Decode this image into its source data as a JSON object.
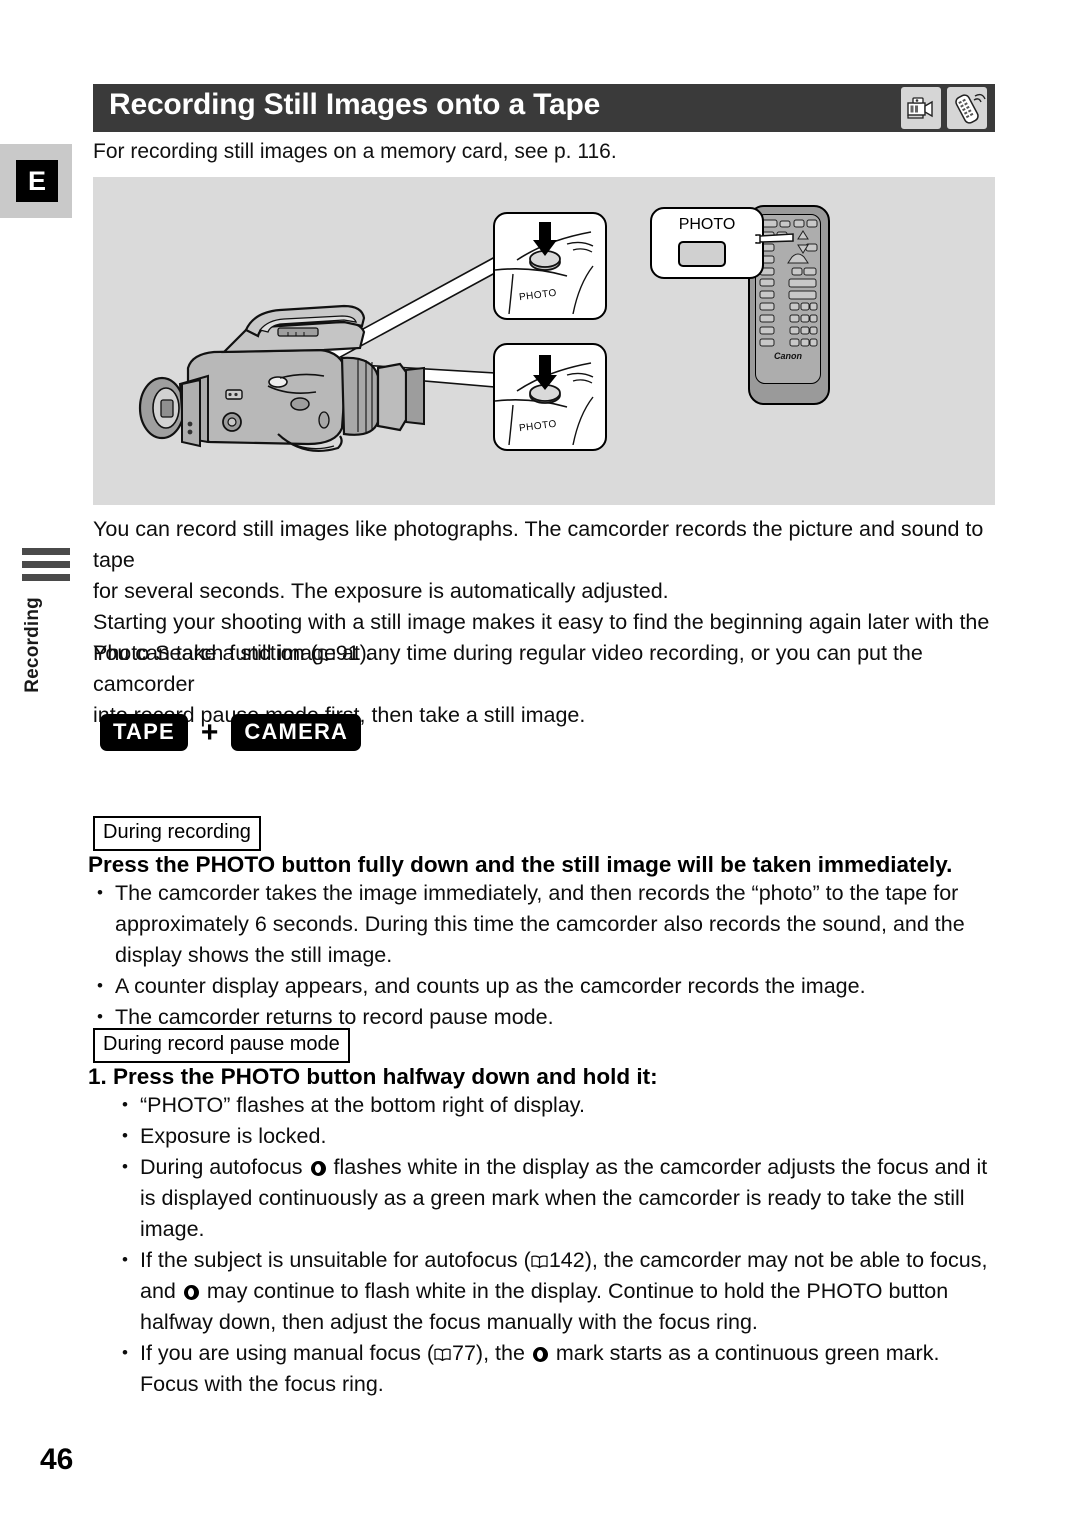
{
  "page": {
    "number": "46",
    "language_tab": "E",
    "side_tab_label": "Recording"
  },
  "header": {
    "title": "Recording Still Images onto a Tape",
    "icons": [
      "camcorder-icon",
      "remote-control-icon"
    ]
  },
  "intro": "For recording still images on a memory card, see p. 116.",
  "illustration": {
    "detail_box_1_label": "PHOTO",
    "detail_box_2_label": "PHOTO",
    "remote_callout_label": "PHOTO",
    "remote_brand": "Canon"
  },
  "paragraphs": {
    "p1_line1": "You can record still images like photographs. The camcorder records the picture and sound to tape",
    "p1_line2": "for several seconds. The exposure is automatically adjusted.",
    "p1_line3": "Starting your shooting with a still image makes it easy to find the beginning again later with the",
    "p1_line4_pre": "Photo Search function (",
    "p1_line4_ref": "91",
    "p1_line4_post": ").",
    "p2_line1": "You can take a still image at any time during regular video recording, or you can put the camcorder",
    "p2_line2": "into record pause mode first, then take a still image."
  },
  "modes": {
    "tape": "TAPE",
    "plus": "+",
    "camera": "CAMERA"
  },
  "section1": {
    "box_label": "During recording",
    "lead": "Press the PHOTO button fully down and the still image will be taken immediately.",
    "bullets": [
      "The camcorder takes the image immediately, and then records the “photo” to the tape for approximately 6 seconds. During this time the camcorder also records the sound, and the display shows the still image.",
      "A counter display appears, and counts up as the camcorder records the image.",
      "The camcorder returns to record pause mode."
    ]
  },
  "section2": {
    "box_label": "During record pause mode",
    "lead": "1. Press the PHOTO button halfway down and hold it:",
    "bullets": [
      {
        "text": "“PHOTO” flashes at the bottom right of display."
      },
      {
        "text": "Exposure is locked."
      },
      {
        "pre": "During autofocus ",
        "mark": "focus-mark",
        "post": " flashes white in the display as the camcorder adjusts the focus and it is displayed continuously as a green mark when the camcorder is ready to take the still image."
      },
      {
        "pre": "If the subject is unsuitable for autofocus (",
        "ref": "142",
        "mid": "), the camcorder may not be able to focus, and ",
        "post": " may continue to flash white in the display. Continue to hold the PHOTO button halfway down, then adjust the focus manually with the focus ring."
      },
      {
        "pre": "If you are using manual focus (",
        "ref": "77",
        "mid": "), the ",
        "post": " mark starts as a continuous green mark. Focus with the focus ring."
      }
    ]
  },
  "colors": {
    "header_bg": "#3a3a3a",
    "illustration_bg": "#dadada",
    "tab_bg": "#c9c9c9",
    "badge_bg": "#000000"
  }
}
